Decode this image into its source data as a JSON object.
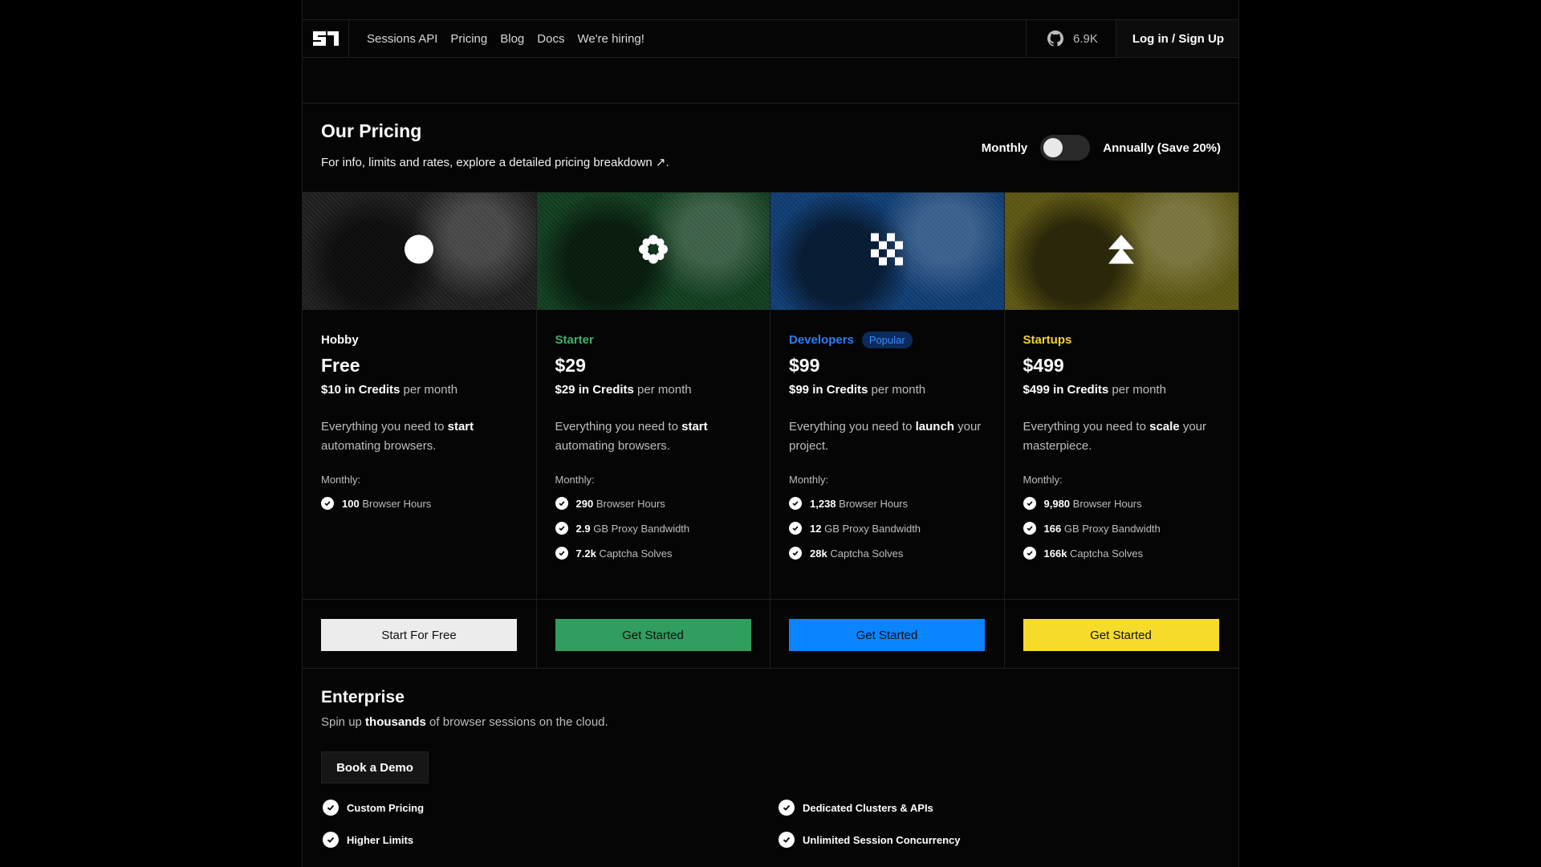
{
  "nav": {
    "links": [
      "Sessions API",
      "Pricing",
      "Blog",
      "Docs",
      "We're hiring!"
    ],
    "github_stars": "6.9K",
    "login_label": "Log in / Sign Up"
  },
  "header": {
    "title": "Our Pricing",
    "subtitle": "For info, limits and rates, explore a detailed pricing breakdown ↗.",
    "toggle_monthly": "Monthly",
    "toggle_annually": "Annually (Save 20%)",
    "billing_annual_enabled": false
  },
  "plans": [
    {
      "name": "Hobby",
      "name_color": "#ffffff",
      "badge": "",
      "price": "Free",
      "credits": "$10 in Credits",
      "credits_suffix": "per month",
      "desc_pre": "Everything you need to ",
      "desc_bold": "start",
      "desc_post": " automating browsers.",
      "monthly_label": "Monthly:",
      "features": [
        {
          "value": "100",
          "label": "Browser Hours"
        }
      ],
      "button": "Start For Free",
      "button_color": "#ececec",
      "image_tint": "#1c1c1c",
      "icon": "circle-icon"
    },
    {
      "name": "Starter",
      "name_color": "#3fae6a",
      "badge": "",
      "price": "$29",
      "credits": "$29 in Credits",
      "credits_suffix": "per month",
      "desc_pre": "Everything you need to ",
      "desc_bold": "start",
      "desc_post": " automating browsers.",
      "monthly_label": "Monthly:",
      "features": [
        {
          "value": "290",
          "label": "Browser Hours"
        },
        {
          "value": "2.9",
          "label": "GB Proxy Bandwidth"
        },
        {
          "value": "7.2k",
          "label": "Captcha Solves"
        }
      ],
      "button": "Get Started",
      "button_color": "#2f9e5e",
      "image_tint": "#0f3b1c",
      "icon": "flower-icon"
    },
    {
      "name": "Developers",
      "name_color": "#2d7ff9",
      "badge": "Popular",
      "price": "$99",
      "credits": "$99 in Credits",
      "credits_suffix": "per month",
      "desc_pre": "Everything you need to ",
      "desc_bold": "launch",
      "desc_post": " your project.",
      "monthly_label": "Monthly:",
      "features": [
        {
          "value": "1,238",
          "label": "Browser Hours"
        },
        {
          "value": "12",
          "label": "GB Proxy Bandwidth"
        },
        {
          "value": "28k",
          "label": "Captcha Solves"
        }
      ],
      "button": "Get Started",
      "button_color": "#0a84ff",
      "image_tint": "#0d3a70",
      "icon": "checker-icon"
    },
    {
      "name": "Startups",
      "name_color": "#f2d22e",
      "badge": "",
      "price": "$499",
      "credits": "$499 in Credits",
      "credits_suffix": "per month",
      "desc_pre": "Everything you need to ",
      "desc_bold": "scale",
      "desc_post": " your masterpiece.",
      "monthly_label": "Monthly:",
      "features": [
        {
          "value": "9,980",
          "label": "Browser Hours"
        },
        {
          "value": "166",
          "label": "GB Proxy Bandwidth"
        },
        {
          "value": "166k",
          "label": "Captcha Solves"
        }
      ],
      "button": "Get Started",
      "button_color": "#f5dc2a",
      "image_tint": "#5a5310",
      "icon": "arrow-up-icon"
    }
  ],
  "enterprise": {
    "title": "Enterprise",
    "sub_pre": "Spin up ",
    "sub_bold": "thousands",
    "sub_post": " of browser sessions on the cloud.",
    "button": "Book a Demo",
    "features_left": [
      "Custom Pricing",
      "Higher Limits"
    ],
    "features_right": [
      "Dedicated Clusters & APIs",
      "Unlimited Session Concurrency"
    ]
  }
}
